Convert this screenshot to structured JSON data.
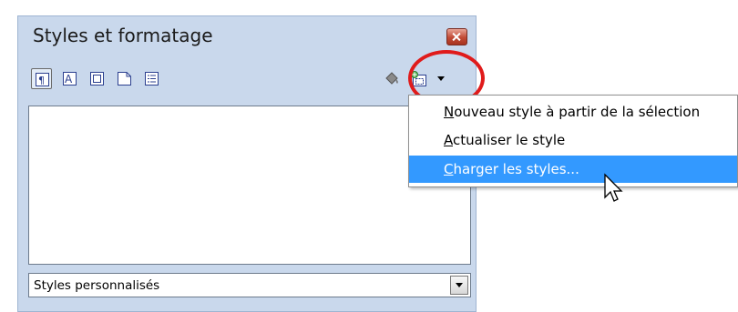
{
  "panel": {
    "title": "Styles et formatage",
    "toolbar": {
      "buttons": [
        {
          "name": "paragraph-styles",
          "icon": "paragraph-style-icon",
          "selected": true
        },
        {
          "name": "character-styles",
          "icon": "character-style-icon"
        },
        {
          "name": "frame-styles",
          "icon": "frame-style-icon"
        },
        {
          "name": "page-styles",
          "icon": "page-style-icon"
        },
        {
          "name": "list-styles",
          "icon": "list-style-icon"
        },
        {
          "name": "fill-format-mode",
          "icon": "fill-bucket-icon"
        },
        {
          "name": "new-style-menu",
          "icon": "new-style-from-selection-icon"
        }
      ]
    },
    "filter": {
      "value": "Styles personnalisés"
    }
  },
  "menu": {
    "items": [
      {
        "label": "Nouveau style à partir de la sélection",
        "mnemonic": "N"
      },
      {
        "label": "Actualiser le style",
        "mnemonic": "A"
      },
      {
        "label": "Charger les styles...",
        "mnemonic": "C",
        "highlighted": true
      }
    ]
  },
  "colors": {
    "panel_bg": "#c9d8ec",
    "highlight_ring": "#e01b1b",
    "menu_selection": "#3399ff"
  }
}
